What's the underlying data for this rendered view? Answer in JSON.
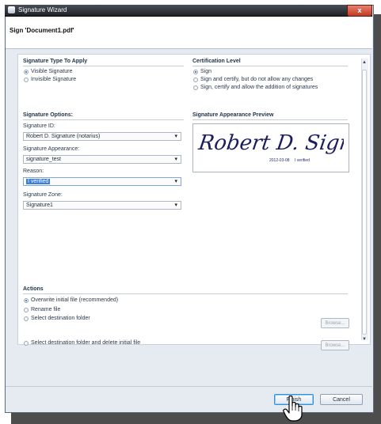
{
  "window": {
    "title": "Signature Wizard",
    "close_glyph": "x"
  },
  "header": {
    "title": "Sign 'Document1.pdf'"
  },
  "signature_type": {
    "heading": "Signature Type To Apply",
    "options": [
      {
        "label": "Visible Signature",
        "selected": true
      },
      {
        "label": "Invisible Signature",
        "selected": false
      }
    ]
  },
  "certification": {
    "heading": "Certification Level",
    "options": [
      {
        "label": "Sign",
        "selected": true
      },
      {
        "label": "Sign and certify, but do not allow any changes",
        "selected": false
      },
      {
        "label": "Sign, certify and allow the addition of signatures",
        "selected": false
      }
    ]
  },
  "signature_options": {
    "heading": "Signature Options:",
    "id_label": "Signature ID:",
    "id_value": "Robert D. Signature (notarius)",
    "appearance_label": "Signature Appearance:",
    "appearance_value": "signature_test",
    "reason_label": "Reason:",
    "reason_value": "I verified",
    "zone_label": "Signature Zone:",
    "zone_value": "Signature1"
  },
  "preview": {
    "heading": "Signature Appearance Preview",
    "signature_script": "Robert D. Signature",
    "date": "2012-03-08",
    "reason": "I verified"
  },
  "actions": {
    "heading": "Actions",
    "options": [
      {
        "label": "Overwrite initial file (recommended)",
        "selected": true
      },
      {
        "label": "Rename file",
        "selected": false
      },
      {
        "label": "Select destination folder",
        "selected": false
      },
      {
        "label": "Select destination folder and delete initial file",
        "selected": false
      }
    ],
    "browse_label": "Browse..."
  },
  "footer": {
    "finish_label": "Finish",
    "cancel_label": "Cancel"
  },
  "icons": {
    "dropdown": "chevron-down-icon",
    "cursor": "hand-pointer-icon"
  },
  "colors": {
    "selection": "#3b7fd8",
    "titlebar": "#1e2126",
    "close": "#c03a24"
  }
}
